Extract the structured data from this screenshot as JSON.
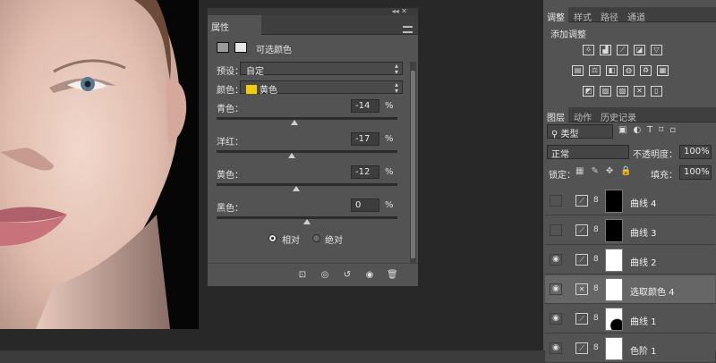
{
  "photo": {
    "label": "portrait-photo"
  },
  "properties_panel": {
    "tab_title": "属性",
    "adjustment_title": "可选颜色",
    "preset_label": "预设：",
    "preset_value": "自定",
    "colors_label": "颜色：",
    "colors_value": "黄色",
    "colors_swatch": "#f2cc00",
    "sliders": [
      {
        "label": "青色：",
        "value": "-14",
        "unit": "%",
        "level": -0.14
      },
      {
        "label": "洋红：",
        "value": "-17",
        "unit": "%",
        "level": -0.17
      },
      {
        "label": "黄色：",
        "value": "-12",
        "unit": "%",
        "level": -0.12
      },
      {
        "label": "黑色：",
        "value": "0",
        "unit": "%",
        "level": 0
      }
    ],
    "method_relative": "相对",
    "method_absolute": "绝对",
    "method_selected": "relative",
    "bottom_icons": [
      "clip-to-layer-icon",
      "view-previous-icon",
      "reset-icon",
      "visibility-icon",
      "delete-icon"
    ]
  },
  "right_panel": {
    "top_tabs": [
      "调整",
      "样式",
      "路径",
      "通道"
    ],
    "adjust_title": "添加调整",
    "adjust_icons_row1": [
      "brightness-icon",
      "levels-icon",
      "curves-icon",
      "exposure-icon",
      "vibrance-icon"
    ],
    "adjust_icons_row2": [
      "hue-saturation-icon",
      "color-balance-icon",
      "black-white-icon",
      "photo-filter-icon",
      "channel-mixer-icon",
      "color-lookup-icon"
    ],
    "adjust_icons_row3": [
      "invert-icon",
      "posterize-icon",
      "threshold-icon",
      "selective-color-icon",
      "gradient-map-icon"
    ],
    "layers_tabs": [
      "图层",
      "动作",
      "历史记录"
    ],
    "kind_label": "类型",
    "blend_mode": "正常",
    "opacity_label": "不透明度：",
    "opacity_value": "100%",
    "lock_label": "锁定：",
    "fill_label": "填充：",
    "fill_value": "100%",
    "layers": [
      {
        "name": "曲线 4",
        "visible": false
      },
      {
        "name": "曲线 3",
        "visible": false
      },
      {
        "name": "曲线 2",
        "visible": true
      },
      {
        "name": "选取颜色 4",
        "visible": true,
        "selected": true
      },
      {
        "name": "曲线 1",
        "visible": true
      },
      {
        "name": "色阶 1",
        "visible": true
      }
    ]
  }
}
